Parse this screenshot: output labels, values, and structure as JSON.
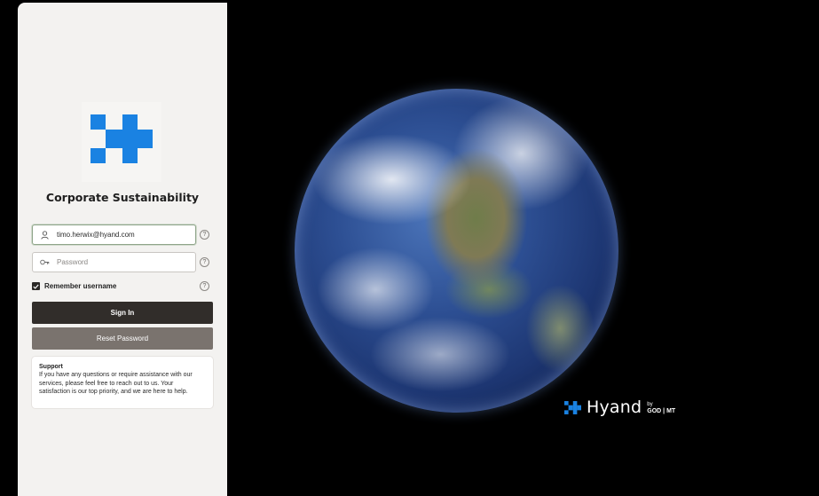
{
  "app": {
    "title": "Corporate Sustainability"
  },
  "login": {
    "username_value": "timo.herwix@hyand.com",
    "password_placeholder": "Password",
    "remember_label": "Remember username",
    "remember_checked": true,
    "signin_label": "Sign In",
    "reset_label": "Reset Password",
    "help_symbol": "?"
  },
  "support": {
    "title": "Support",
    "text": "If you have any questions or require assistance with our services, please feel free to reach out to us. Your satisfaction is our top priority, and we are here to help."
  },
  "brand": {
    "name": "Hyand",
    "by": "by",
    "org": "GOD | MT"
  },
  "icons": {
    "logo": "plus-cross-logo-icon",
    "user": "user-icon",
    "key": "key-icon",
    "help": "help-circle-icon",
    "check": "check-icon"
  },
  "colors": {
    "brand_blue": "#1a82e2",
    "panel_bg": "#f3f2f0",
    "signin_bg": "#312d2a",
    "reset_bg": "#7a736e"
  }
}
